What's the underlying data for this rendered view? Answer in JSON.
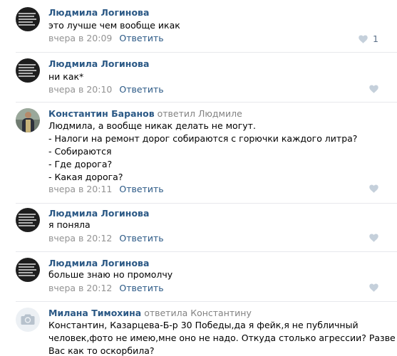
{
  "comments": [
    {
      "author": "Людмила Логинова",
      "replied": "",
      "lines": [
        "это лучше чем вообще икак"
      ],
      "time": "вчера в 20:09",
      "reply_label": "Ответить",
      "likes": "1",
      "avatar": "logo-avatar"
    },
    {
      "author": "Людмила Логинова",
      "replied": "",
      "lines": [
        "ни как*"
      ],
      "time": "вчера в 20:10",
      "reply_label": "Ответить",
      "likes": "",
      "avatar": "logo-avatar"
    },
    {
      "author": "Константин Баранов",
      "replied": "ответил Людмиле",
      "lines": [
        "Людмила, а вообще никак делать не могут.",
        "- Налоги на ремонт дорог собираются с горючки каждого литра?",
        "- Собираются",
        "- Где дорога?",
        "- Какая дорога?"
      ],
      "time": "вчера в 20:11",
      "reply_label": "Ответить",
      "likes": "",
      "avatar": "photo-avatar"
    },
    {
      "author": "Людмила Логинова",
      "replied": "",
      "lines": [
        "я поняла"
      ],
      "time": "вчера в 20:12",
      "reply_label": "Ответить",
      "likes": "",
      "avatar": "logo-avatar"
    },
    {
      "author": "Людмила Логинова",
      "replied": "",
      "lines": [
        "больше знаю но промолчу"
      ],
      "time": "вчера в 20:12",
      "reply_label": "Ответить",
      "likes": "",
      "avatar": "logo-avatar"
    },
    {
      "author": "Милана Тимохина",
      "replied": "ответила Константину",
      "lines": [
        "Константин, Казарцева-Б-р 30 Победы,да я фейк,я не публичный",
        "человек,фото не имею,мне оно не надо. Откуда столько агрессии? Разве я",
        "Вас как то оскорбила?"
      ],
      "time": "",
      "reply_label": "",
      "likes": "",
      "avatar": "camera-avatar"
    }
  ],
  "colors": {
    "author": "#2a5885",
    "muted": "#939393",
    "divider": "#e7e8ec",
    "heart": "#c5d0db",
    "like_count": "#5a6f88"
  },
  "icons": {
    "like": "heart-icon",
    "no_photo": "camera-icon"
  }
}
